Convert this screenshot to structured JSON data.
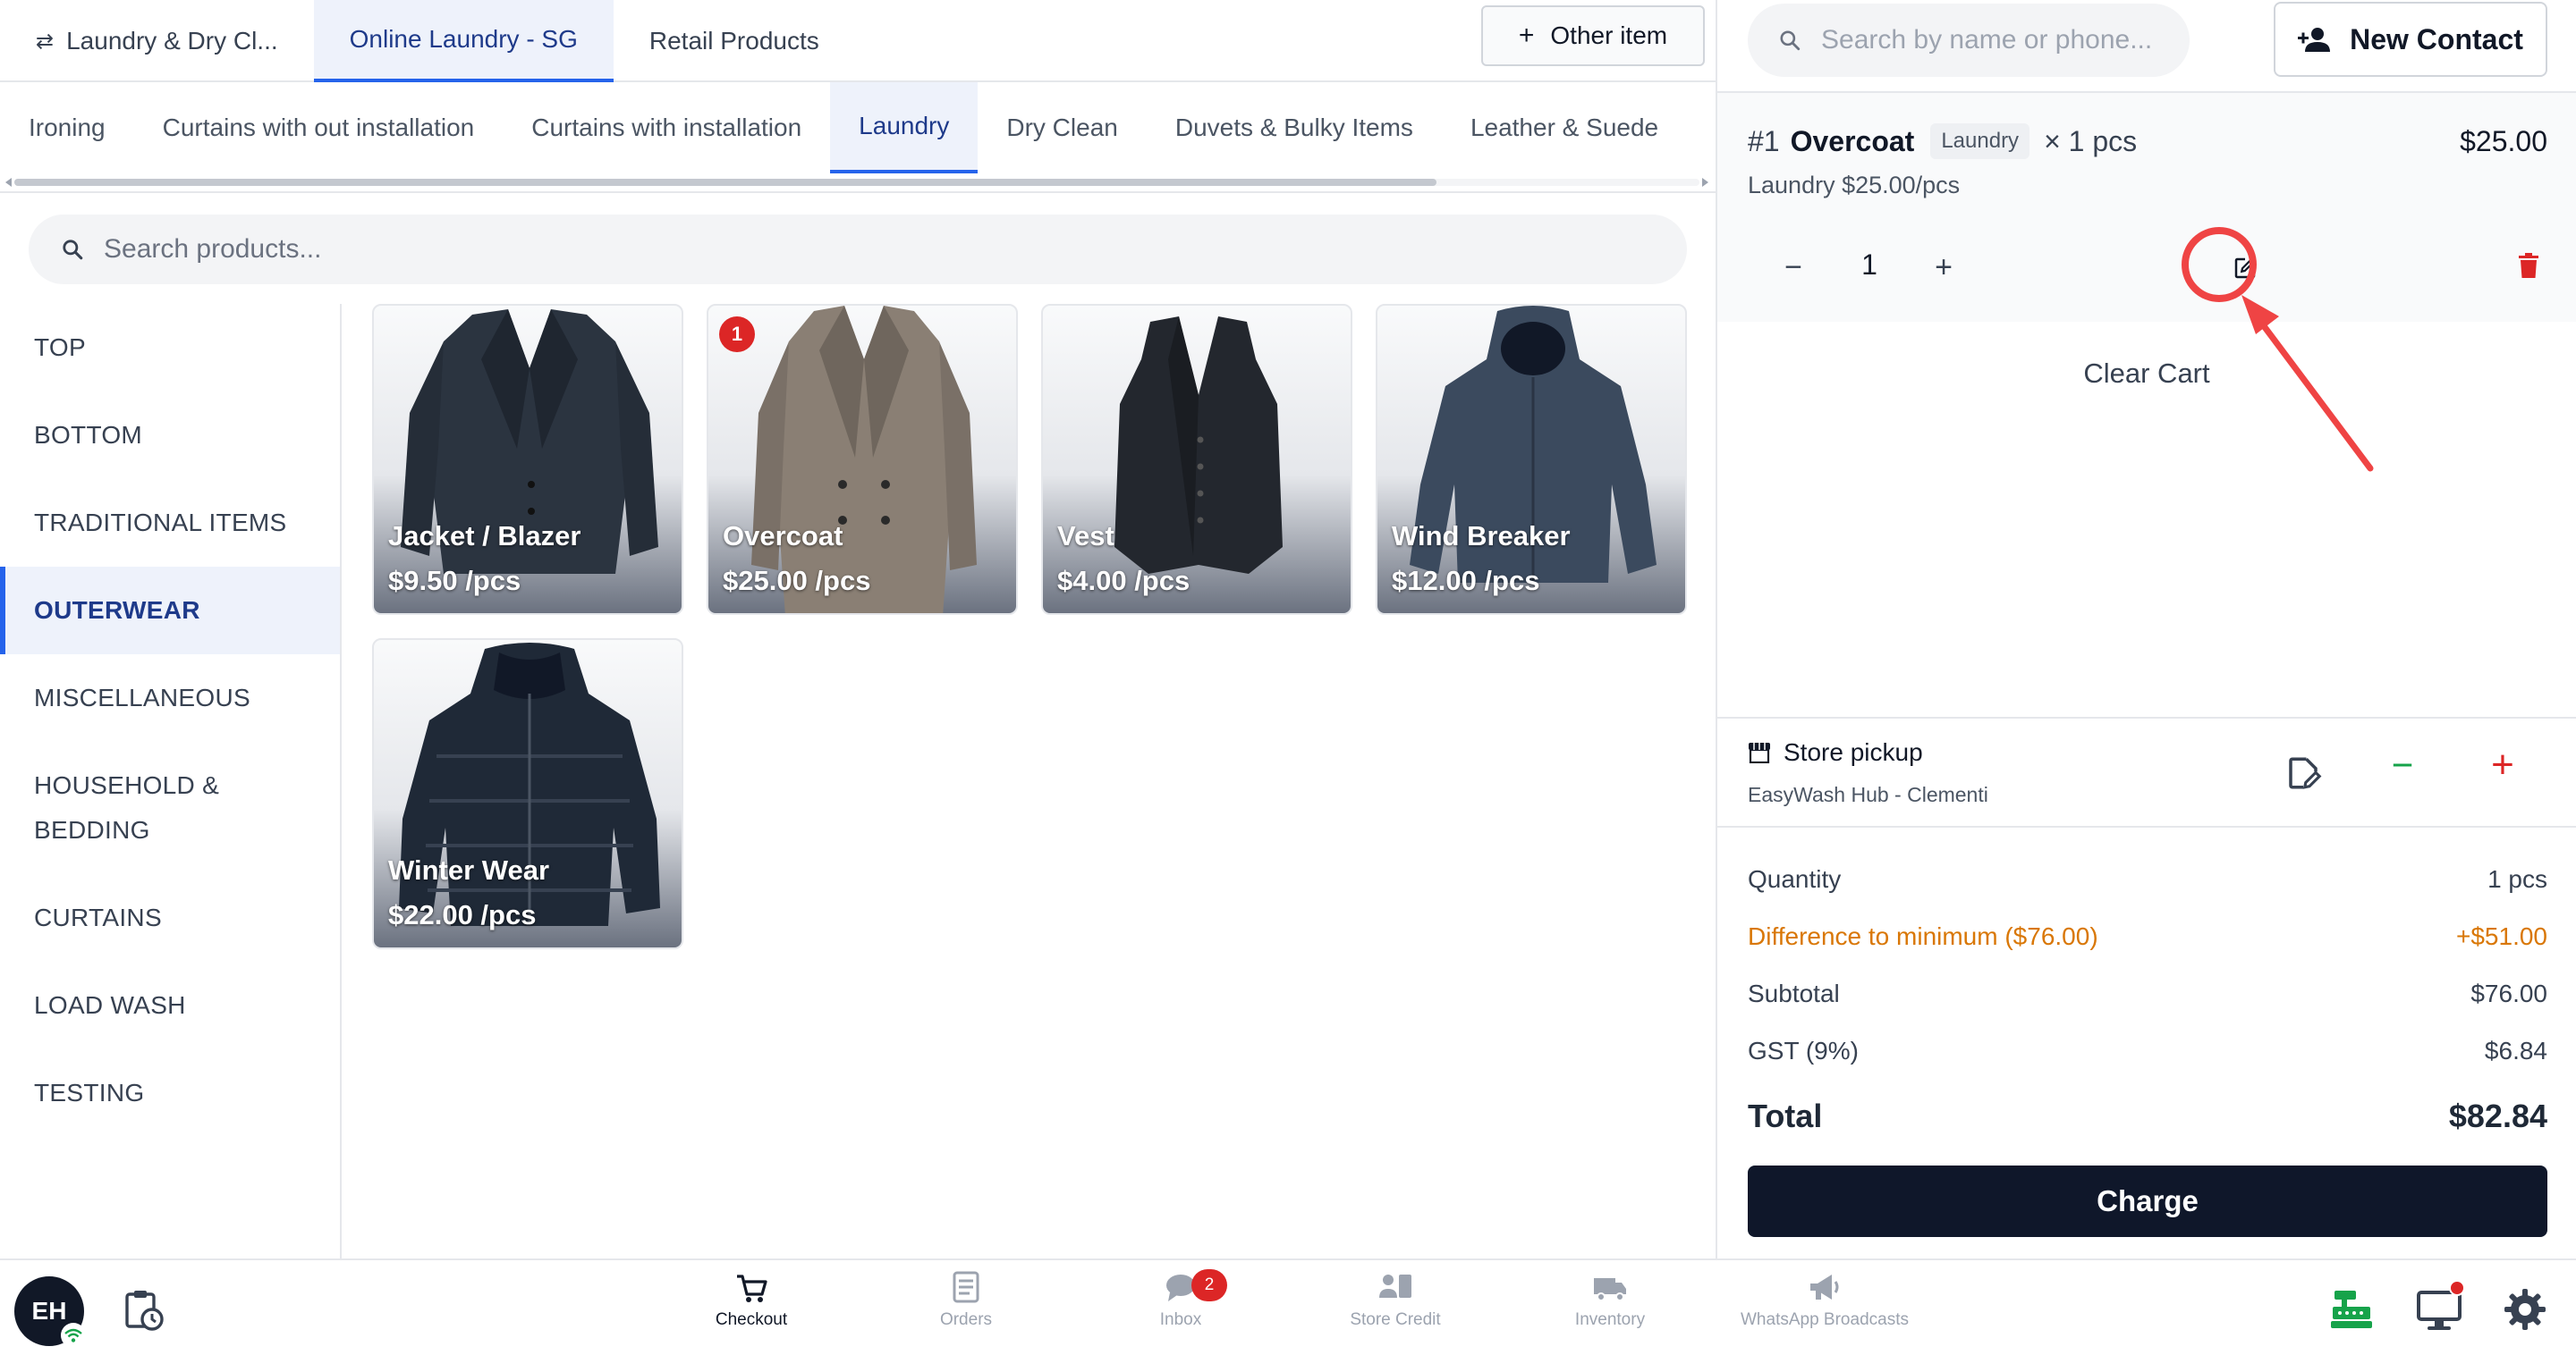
{
  "store_tabs": [
    {
      "label": "Laundry & Dry Cl..."
    },
    {
      "label": "Online Laundry - SG"
    },
    {
      "label": "Retail Products"
    }
  ],
  "other_item_label": "Other item",
  "category_tabs": [
    {
      "label": "Ironing"
    },
    {
      "label": "Curtains with out installation"
    },
    {
      "label": "Curtains with installation"
    },
    {
      "label": "Laundry"
    },
    {
      "label": "Dry Clean"
    },
    {
      "label": "Duvets & Bulky Items"
    },
    {
      "label": "Leather & Suede"
    }
  ],
  "product_search": {
    "placeholder": "Search products..."
  },
  "categories": [
    {
      "label": "TOP"
    },
    {
      "label": "BOTTOM"
    },
    {
      "label": "TRADITIONAL ITEMS"
    },
    {
      "label": "OUTERWEAR"
    },
    {
      "label": "MISCELLANEOUS"
    },
    {
      "label": "HOUSEHOLD & BEDDING"
    },
    {
      "label": "CURTAINS"
    },
    {
      "label": "LOAD WASH"
    },
    {
      "label": "TESTING"
    }
  ],
  "products": [
    {
      "name": "Jacket / Blazer",
      "price": "$9.50 /pcs",
      "icon": "blazer-image"
    },
    {
      "name": "Overcoat",
      "price": "$25.00 /pcs",
      "badge": "1",
      "icon": "overcoat-image"
    },
    {
      "name": "Vest",
      "price": "$4.00 /pcs",
      "icon": "vest-image"
    },
    {
      "name": "Wind Breaker",
      "price": "$12.00 /pcs",
      "icon": "windbreaker-image"
    },
    {
      "name": "Winter Wear",
      "price": "$22.00 /pcs",
      "icon": "puffer-jacket-image"
    }
  ],
  "contact_search": {
    "placeholder": "Search by name or phone..."
  },
  "new_contact_label": "New Contact",
  "cart": {
    "items": [
      {
        "index": "#1",
        "name": "Overcoat",
        "tag": "Laundry",
        "qty_text": "× 1 pcs",
        "price": "$25.00",
        "sub": "Laundry $25.00/pcs",
        "quantity": "1"
      }
    ],
    "clear_label": "Clear Cart"
  },
  "pickup": {
    "title": "Store pickup",
    "location": "EasyWash Hub - Clementi"
  },
  "summary": {
    "quantity_label": "Quantity",
    "quantity_value": "1 pcs",
    "diff_label": "Difference to minimum ($76.00)",
    "diff_value": "+$51.00",
    "subtotal_label": "Subtotal",
    "subtotal_value": "$76.00",
    "gst_label": "GST (9%)",
    "gst_value": "$6.84",
    "total_label": "Total",
    "total_value": "$82.84"
  },
  "charge_label": "Charge",
  "bottom_nav": {
    "avatar_initials": "EH",
    "items": [
      {
        "label": "Checkout",
        "icon": "cart-icon"
      },
      {
        "label": "Orders",
        "icon": "orders-icon"
      },
      {
        "label": "Inbox",
        "icon": "chat-icon",
        "badge": "2"
      },
      {
        "label": "Store Credit",
        "icon": "store-credit-icon"
      },
      {
        "label": "Inventory",
        "icon": "truck-icon"
      },
      {
        "label": "WhatsApp Broadcasts",
        "icon": "megaphone-icon"
      }
    ]
  },
  "colors": {
    "accent_blue": "#2563eb",
    "active_bg": "#eef2fb",
    "danger": "#dc2626",
    "success": "#16a34a",
    "warning": "#d97706",
    "charge_bg": "#0f172a",
    "annotation": "#ef4444"
  }
}
